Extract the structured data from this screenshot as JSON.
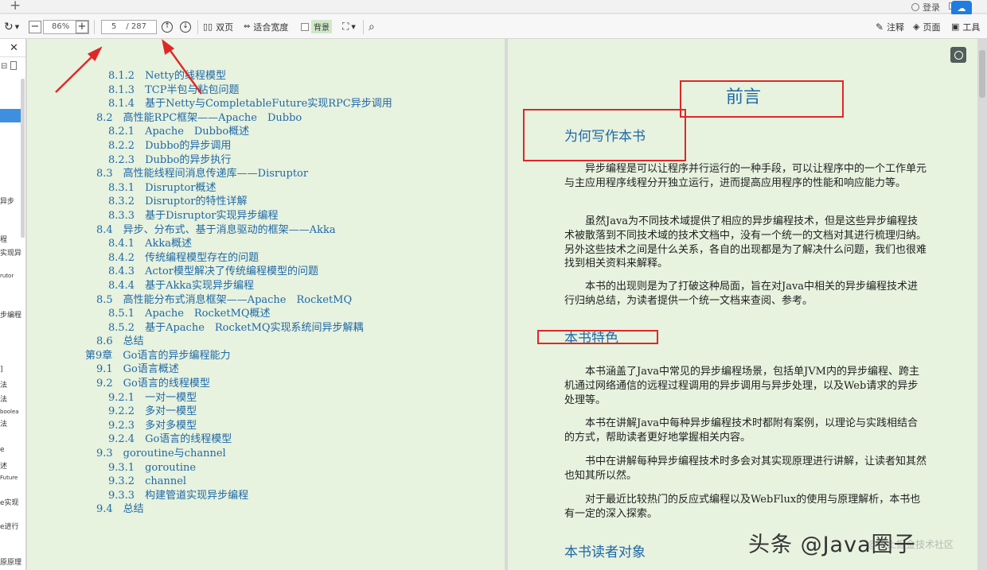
{
  "titlebar": {
    "login_label": "登录"
  },
  "toolbar": {
    "zoom": "86%",
    "page_current": "5",
    "page_total": "/ 287",
    "two_page_label": "双页",
    "fit_width_label": "适合宽度",
    "background_label": "背景",
    "annotate_label": "注释",
    "page_label": "页面",
    "tools_label": "工具"
  },
  "left_panel": {
    "fragments": [
      "异步",
      "程",
      "实现异",
      "rutor",
      "步编程",
      "]",
      "法",
      "法",
      "boolea",
      "法",
      "e",
      "述",
      "Future",
      "e实现",
      "e进行",
      "原原理"
    ]
  },
  "left_page": {
    "toc": [
      {
        "level": 2,
        "text": "8.1.2　Netty的线程模型"
      },
      {
        "level": 2,
        "text": "8.1.3　TCP半包与粘包问题"
      },
      {
        "level": 2,
        "text": "8.1.4　基于Netty与CompletableFuture实现RPC异步调用"
      },
      {
        "level": 1,
        "text": "8.2　高性能RPC框架——Apache　Dubbo"
      },
      {
        "level": 2,
        "text": "8.2.1　Apache　Dubbo概述"
      },
      {
        "level": 2,
        "text": "8.2.2　Dubbo的异步调用"
      },
      {
        "level": 2,
        "text": "8.2.3　Dubbo的异步执行"
      },
      {
        "level": 1,
        "text": "8.3　高性能线程间消息传递库——Disruptor"
      },
      {
        "level": 2,
        "text": "8.3.1　Disruptor概述"
      },
      {
        "level": 2,
        "text": "8.3.2　Disruptor的特性详解"
      },
      {
        "level": 2,
        "text": "8.3.3　基于Disruptor实现异步编程"
      },
      {
        "level": 1,
        "text": "8.4　异步、分布式、基于消息驱动的框架——Akka"
      },
      {
        "level": 2,
        "text": "8.4.1　Akka概述"
      },
      {
        "level": 2,
        "text": "8.4.2　传统编程模型存在的问题"
      },
      {
        "level": 2,
        "text": "8.4.3　Actor模型解决了传统编程模型的问题"
      },
      {
        "level": 2,
        "text": "8.4.4　基于Akka实现异步编程"
      },
      {
        "level": 1,
        "text": "8.5　高性能分布式消息框架——Apache　RocketMQ"
      },
      {
        "level": 2,
        "text": "8.5.1　Apache　RocketMQ概述"
      },
      {
        "level": 2,
        "text": "8.5.2　基于Apache　RocketMQ实现系统间异步解耦"
      },
      {
        "level": 1,
        "text": "8.6　总结"
      },
      {
        "level": 0,
        "text": "第9章　Go语言的异步编程能力"
      },
      {
        "level": 1,
        "text": "9.1　Go语言概述"
      },
      {
        "level": 1,
        "text": "9.2　Go语言的线程模型"
      },
      {
        "level": 2,
        "text": "9.2.1　一对一模型"
      },
      {
        "level": 2,
        "text": "9.2.2　多对一模型"
      },
      {
        "level": 2,
        "text": "9.2.3　多对多模型"
      },
      {
        "level": 2,
        "text": "9.2.4　Go语言的线程模型"
      },
      {
        "level": 1,
        "text": "9.3　goroutine与channel"
      },
      {
        "level": 2,
        "text": "9.3.1　goroutine"
      },
      {
        "level": 2,
        "text": "9.3.2　channel"
      },
      {
        "level": 2,
        "text": "9.3.3　构建管道实现异步编程"
      },
      {
        "level": 1,
        "text": "9.4　总结"
      }
    ]
  },
  "right_page": {
    "title": "前言",
    "section1": "为何写作本书",
    "p1": "异步编程是可以让程序并行运行的一种手段，可以让程序中的一个工作单元与主应用程序线程分开独立运行，进而提高应用程序的性能和响应能力等。",
    "p2": "虽然Java为不同技术域提供了相应的异步编程技术，但是这些异步编程技术被散落到不同技术域的技术文档中，没有一个统一的文档对其进行梳理归纳。另外这些技术之间是什么关系，各自的出现都是为了解决什么问题，我们也很难找到相关资料来解释。",
    "p3": "本书的出现则是为了打破这种局面，旨在对Java中相关的异步编程技术进行归纳总结，为读者提供一个统一文档来查阅、参考。",
    "section2": "本书特色",
    "p4": "本书涵盖了Java中常见的异步编程场景，包括单JVM内的异步编程、跨主机通过网络通信的远程过程调用的异步调用与异步处理，以及Web请求的异步处理等。",
    "p5": "本书在讲解Java中每种异步编程技术时都附有案例，以理论与实践相结合的方式，帮助读者更好地掌握相关内容。",
    "p6": "书中在讲解每种异步编程技术时多会对其实现原理进行讲解，让读者知其然也知其所以然。",
    "p7": "对于最近比较热门的反应式编程以及WebFlux的使用与原理解析，本书也有一定的深入探索。",
    "section3": "本书读者对象"
  },
  "watermark": {
    "text": "头条 @Java圈子",
    "sub": "@稀土掘金技术社区"
  },
  "colors": {
    "page_bg": "#e7f2df",
    "heading": "#1f68a6",
    "annotation": "#e02727"
  }
}
